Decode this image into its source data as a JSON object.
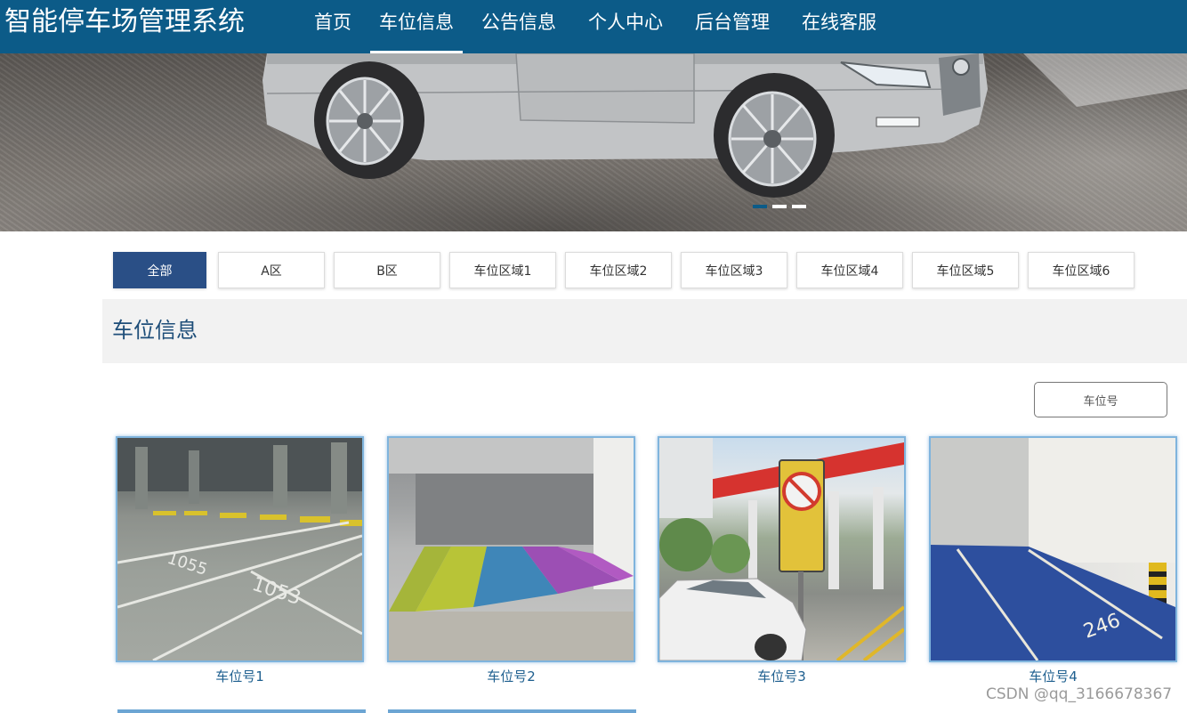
{
  "header": {
    "title": "智能停车场管理系统",
    "nav": [
      {
        "label": "首页",
        "active": false
      },
      {
        "label": "车位信息",
        "active": true
      },
      {
        "label": "公告信息",
        "active": false
      },
      {
        "label": "个人中心",
        "active": false
      },
      {
        "label": "后台管理",
        "active": false
      },
      {
        "label": "在线客服",
        "active": false
      }
    ]
  },
  "banner": {
    "slide_count": 3,
    "active_slide": 1
  },
  "filters": [
    {
      "label": "全部",
      "active": true
    },
    {
      "label": "A区",
      "active": false
    },
    {
      "label": "B区",
      "active": false
    },
    {
      "label": "车位区域1",
      "active": false
    },
    {
      "label": "车位区域2",
      "active": false
    },
    {
      "label": "车位区域3",
      "active": false
    },
    {
      "label": "车位区域4",
      "active": false
    },
    {
      "label": "车位区域5",
      "active": false
    },
    {
      "label": "车位区域6",
      "active": false
    }
  ],
  "section": {
    "title": "车位信息"
  },
  "search": {
    "button_label": "车位号"
  },
  "cards": [
    {
      "label": "车位号1",
      "image": "underground-garage-spots-1053"
    },
    {
      "label": "车位号2",
      "image": "colored-parking-bays"
    },
    {
      "label": "车位号3",
      "image": "gas-station-no-parking-sign"
    },
    {
      "label": "车位号4",
      "image": "blue-floor-spot-246"
    }
  ],
  "watermark": "CSDN @qq_3166678367",
  "colors": {
    "header_bg": "#0c5b88",
    "filter_active": "#2a4f86",
    "section_title": "#1e4e79",
    "card_label": "#1e5f8f"
  }
}
